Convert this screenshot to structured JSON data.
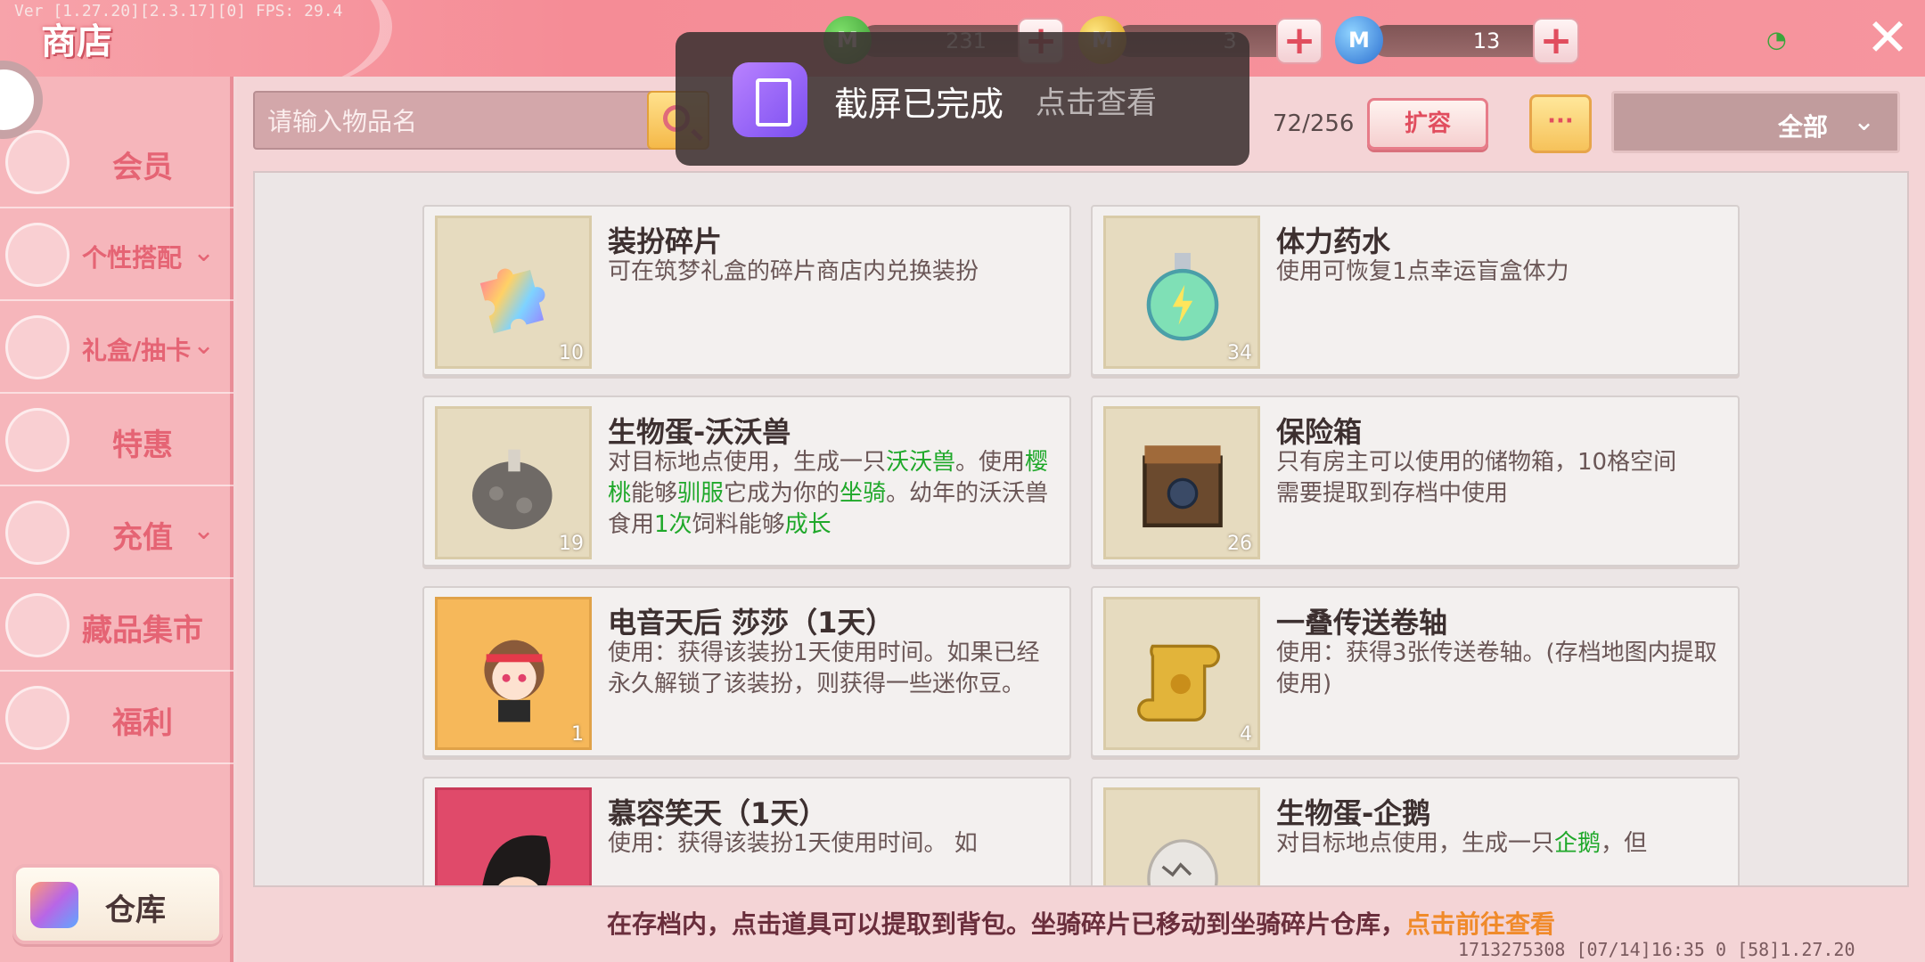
{
  "version_text": "Ver [1.27.20][2.3.17][0] FPS: 29.4",
  "title": "商店",
  "currencies": [
    {
      "icon": "green-gem-coin-icon",
      "color": "#3b9a34",
      "value": "231"
    },
    {
      "icon": "gold-coin-icon",
      "color": "#e8b923",
      "value": "3"
    },
    {
      "icon": "blue-coin-icon",
      "color": "#3c8fe0",
      "value": "13"
    }
  ],
  "sidebar": {
    "items": [
      {
        "label": "会员",
        "icon": "vip-icon",
        "has_chevron": false
      },
      {
        "label": "个性搭配",
        "icon": "trophy-icon",
        "has_chevron": true
      },
      {
        "label": "礼盒/抽卡",
        "icon": "gift-wheel-icon",
        "has_chevron": true
      },
      {
        "label": "特惠",
        "icon": "discount-box-icon",
        "has_chevron": false
      },
      {
        "label": "充值",
        "icon": "coin-stack-icon",
        "has_chevron": true
      },
      {
        "label": "藏品集市",
        "icon": "diamond-icon",
        "has_chevron": false
      },
      {
        "label": "福利",
        "icon": "gift-icon",
        "has_chevron": false
      }
    ],
    "warehouse_label": "仓库"
  },
  "search": {
    "placeholder": "请输入物品名"
  },
  "capacity": "72/256",
  "expand_label": "扩容",
  "more_label": "···",
  "filter": {
    "selected": "全部"
  },
  "toast": {
    "title": "截屏已完成",
    "action": "点击查看"
  },
  "items": [
    {
      "name": "装扮碎片",
      "qty": "10",
      "desc": "可在筑梦礼盒的碎片商店内兑换装扮",
      "icon": "puzzle-piece-icon"
    },
    {
      "name": "体力药水",
      "qty": "34",
      "desc": "使用可恢复1点幸运盲盒体力",
      "icon": "potion-icon"
    },
    {
      "name": "生物蛋-沃沃兽",
      "qty": "19",
      "icon": "egg-icon",
      "desc_parts": [
        "对目标地点使用，生成一只",
        "沃沃兽",
        "。使用",
        "樱桃",
        "能够",
        "驯服",
        "它成为你的",
        "坐骑",
        "。幼年的沃沃兽食用",
        "1次",
        "饲料能够",
        "成长"
      ]
    },
    {
      "name": "保险箱",
      "qty": "26",
      "desc": "只有房主可以使用的储物箱，10格空间",
      "desc2": "需要提取到存档中使用",
      "icon": "safe-box-icon"
    },
    {
      "name": "电音天后 莎莎（1天）",
      "qty": "1",
      "desc": "使用：获得该装扮1天使用时间。如果已经永久解锁了该装扮，则获得一些迷你豆。",
      "icon": "character-avatar-icon"
    },
    {
      "name": "一叠传送卷轴",
      "qty": "4",
      "desc": "使用：获得3张传送卷轴。(存档地图内提取使用)",
      "icon": "scroll-icon"
    },
    {
      "name": "慕容笑天（1天）",
      "qty": "",
      "desc": "使用：获得该装扮1天使用时间。 如",
      "icon": "character-avatar-icon"
    },
    {
      "name": "生物蛋-企鹅",
      "qty": "",
      "icon": "egg-icon",
      "desc_parts": [
        "对目标地点使用，生成一只",
        "企鹅",
        "，但"
      ]
    }
  ],
  "footer": {
    "note": "在存档内，点击道具可以提取到背包。坐骑碎片已移动到坐骑碎片仓库，",
    "link": "点击前往查看"
  },
  "build_info": "1713275308   [07/14]16:35 0   [58]1.27.20"
}
